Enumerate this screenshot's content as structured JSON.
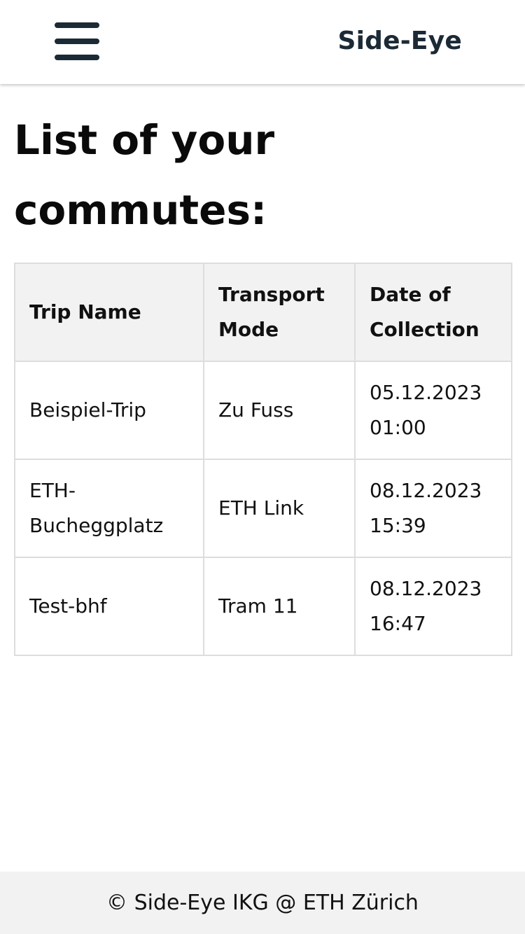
{
  "header": {
    "brand": "Side-Eye",
    "menu_icon": "hamburger-menu-icon"
  },
  "main": {
    "title": "List of your commutes:",
    "table": {
      "columns": [
        "Trip Name",
        "Transport Mode",
        "Date of Collection"
      ],
      "rows": [
        [
          "Beispiel-Trip",
          "Zu Fuss",
          "05.12.2023 01:00"
        ],
        [
          "ETH-Bucheggplatz",
          "ETH Link",
          "08.12.2023 15:39"
        ],
        [
          "Test-bhf",
          "Tram 11",
          "08.12.2023 16:47"
        ]
      ]
    }
  },
  "footer": {
    "text": "© Side-Eye IKG @ ETH Zürich"
  },
  "colors": {
    "brand": "#1c2a36",
    "header_cell_bg": "#f2f2f2",
    "border": "#dddddd",
    "footer_bg": "#f2f2f2"
  }
}
